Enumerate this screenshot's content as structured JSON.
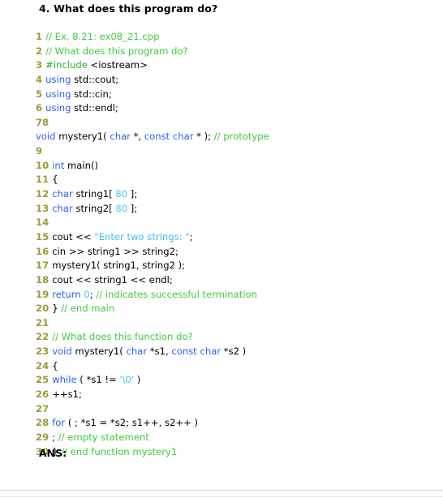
{
  "document": {
    "question": "4. What does this program do?",
    "answer_label": "ANS:",
    "colors": {
      "line_number": "#9a9a3c",
      "comment": "#3ecb3e",
      "keyword": "#2d5ff5",
      "preprocessor": "#2fb22f",
      "number_literal": "#4fc3f7",
      "string_literal": "#3fc0f0",
      "plain": "#000000",
      "background": "#ffffff",
      "rule": "#d9d9d9"
    },
    "code": {
      "language": "cpp",
      "lines": [
        {
          "num": "1",
          "text": "// Ex. 8.21: ex08_21.cpp"
        },
        {
          "num": "2",
          "text": "// What does this program do?"
        },
        {
          "num": "3",
          "text": "#include <iostream>"
        },
        {
          "num": "4",
          "text": "using std::cout;"
        },
        {
          "num": "5",
          "text": "using std::cin;"
        },
        {
          "num": "6",
          "text": "using std::endl;"
        },
        {
          "num": "78",
          "text": ""
        },
        {
          "num": "",
          "text": "void mystery1( char *, const char * ); // prototype"
        },
        {
          "num": "9",
          "text": ""
        },
        {
          "num": "10",
          "text": "int main()"
        },
        {
          "num": "11",
          "text": "{"
        },
        {
          "num": "12",
          "text": "char string1[ 80 ];"
        },
        {
          "num": "13",
          "text": "char string2[ 80 ];"
        },
        {
          "num": "14",
          "text": ""
        },
        {
          "num": "15",
          "text": "cout << \"Enter two strings: \";"
        },
        {
          "num": "16",
          "text": "cin >> string1 >> string2;"
        },
        {
          "num": "17",
          "text": "mystery1( string1, string2 );"
        },
        {
          "num": "18",
          "text": "cout << string1 << endl;"
        },
        {
          "num": "19",
          "text": "return 0; // indicates successful termination"
        },
        {
          "num": "20",
          "text": "} // end main"
        },
        {
          "num": "21",
          "text": ""
        },
        {
          "num": "22",
          "text": "// What does this function do?"
        },
        {
          "num": "23",
          "text": "void mystery1( char *s1, const char *s2 )"
        },
        {
          "num": "24",
          "text": "{"
        },
        {
          "num": "25",
          "text": "while ( *s1 != '\\0' )"
        },
        {
          "num": "26",
          "text": "++s1;"
        },
        {
          "num": "27",
          "text": ""
        },
        {
          "num": "28",
          "text": "for ( ; *s1 = *s2; s1++, s2++ )"
        },
        {
          "num": "29",
          "text": "; // empty statement"
        },
        {
          "num": "30",
          "text": "} // end function mystery1"
        }
      ],
      "tokens": [
        [
          {
            "t": "// Ex. 8.21: ex08_21.cpp",
            "c": "cmt"
          }
        ],
        [
          {
            "t": "// What does this program do?",
            "c": "cmt"
          }
        ],
        [
          {
            "t": "#include",
            "c": "pp"
          },
          {
            "t": " <iostream>",
            "c": "pln"
          }
        ],
        [
          {
            "t": "using",
            "c": "kw"
          },
          {
            "t": " std::cout;",
            "c": "pln"
          }
        ],
        [
          {
            "t": "using",
            "c": "kw"
          },
          {
            "t": " std::cin;",
            "c": "pln"
          }
        ],
        [
          {
            "t": "using",
            "c": "kw"
          },
          {
            "t": " std::endl;",
            "c": "pln"
          }
        ],
        [],
        [
          {
            "t": "void",
            "c": "kw"
          },
          {
            "t": " mystery1( ",
            "c": "pln"
          },
          {
            "t": "char",
            "c": "kw"
          },
          {
            "t": " *, ",
            "c": "pln"
          },
          {
            "t": "const char",
            "c": "kw"
          },
          {
            "t": " * ); ",
            "c": "pln"
          },
          {
            "t": "// prototype",
            "c": "cmt"
          }
        ],
        [],
        [
          {
            "t": "int",
            "c": "kw"
          },
          {
            "t": " main()",
            "c": "pln"
          }
        ],
        [
          {
            "t": "{",
            "c": "pln"
          }
        ],
        [
          {
            "t": "char",
            "c": "kw"
          },
          {
            "t": " string1[ ",
            "c": "pln"
          },
          {
            "t": "80",
            "c": "num"
          },
          {
            "t": " ];",
            "c": "pln"
          }
        ],
        [
          {
            "t": "char",
            "c": "kw"
          },
          {
            "t": " string2[ ",
            "c": "pln"
          },
          {
            "t": "80",
            "c": "num"
          },
          {
            "t": " ];",
            "c": "pln"
          }
        ],
        [],
        [
          {
            "t": "cout << ",
            "c": "pln"
          },
          {
            "t": "\"Enter two strings: \"",
            "c": "str"
          },
          {
            "t": ";",
            "c": "pln"
          }
        ],
        [
          {
            "t": "cin >> string1 >> string2;",
            "c": "pln"
          }
        ],
        [
          {
            "t": "mystery1( string1, string2 );",
            "c": "pln"
          }
        ],
        [
          {
            "t": "cout << string1 << endl;",
            "c": "pln"
          }
        ],
        [
          {
            "t": "return",
            "c": "kw"
          },
          {
            "t": " ",
            "c": "pln"
          },
          {
            "t": "0",
            "c": "num"
          },
          {
            "t": "; ",
            "c": "pln"
          },
          {
            "t": "// indicates successful termination",
            "c": "cmt"
          }
        ],
        [
          {
            "t": "} ",
            "c": "pln"
          },
          {
            "t": "// end main",
            "c": "cmt"
          }
        ],
        [],
        [
          {
            "t": "// What does this function do?",
            "c": "cmt"
          }
        ],
        [
          {
            "t": "void",
            "c": "kw"
          },
          {
            "t": " mystery1( ",
            "c": "pln"
          },
          {
            "t": "char",
            "c": "kw"
          },
          {
            "t": " *s1, ",
            "c": "pln"
          },
          {
            "t": "const char",
            "c": "kw"
          },
          {
            "t": " *s2 )",
            "c": "pln"
          }
        ],
        [
          {
            "t": "{",
            "c": "pln"
          }
        ],
        [
          {
            "t": "while",
            "c": "kw"
          },
          {
            "t": " ( *s1 != ",
            "c": "pln"
          },
          {
            "t": "'\\0'",
            "c": "str"
          },
          {
            "t": " )",
            "c": "pln"
          }
        ],
        [
          {
            "t": "++s1;",
            "c": "pln"
          }
        ],
        [],
        [
          {
            "t": "for",
            "c": "kw"
          },
          {
            "t": " ( ; *s1 = *s2; s1++, s2++ )",
            "c": "pln"
          }
        ],
        [
          {
            "t": "; ",
            "c": "pln"
          },
          {
            "t": "// empty statement",
            "c": "cmt"
          }
        ],
        [
          {
            "t": "} ",
            "c": "pln"
          },
          {
            "t": "// end function mystery1",
            "c": "cmt"
          }
        ]
      ]
    }
  }
}
